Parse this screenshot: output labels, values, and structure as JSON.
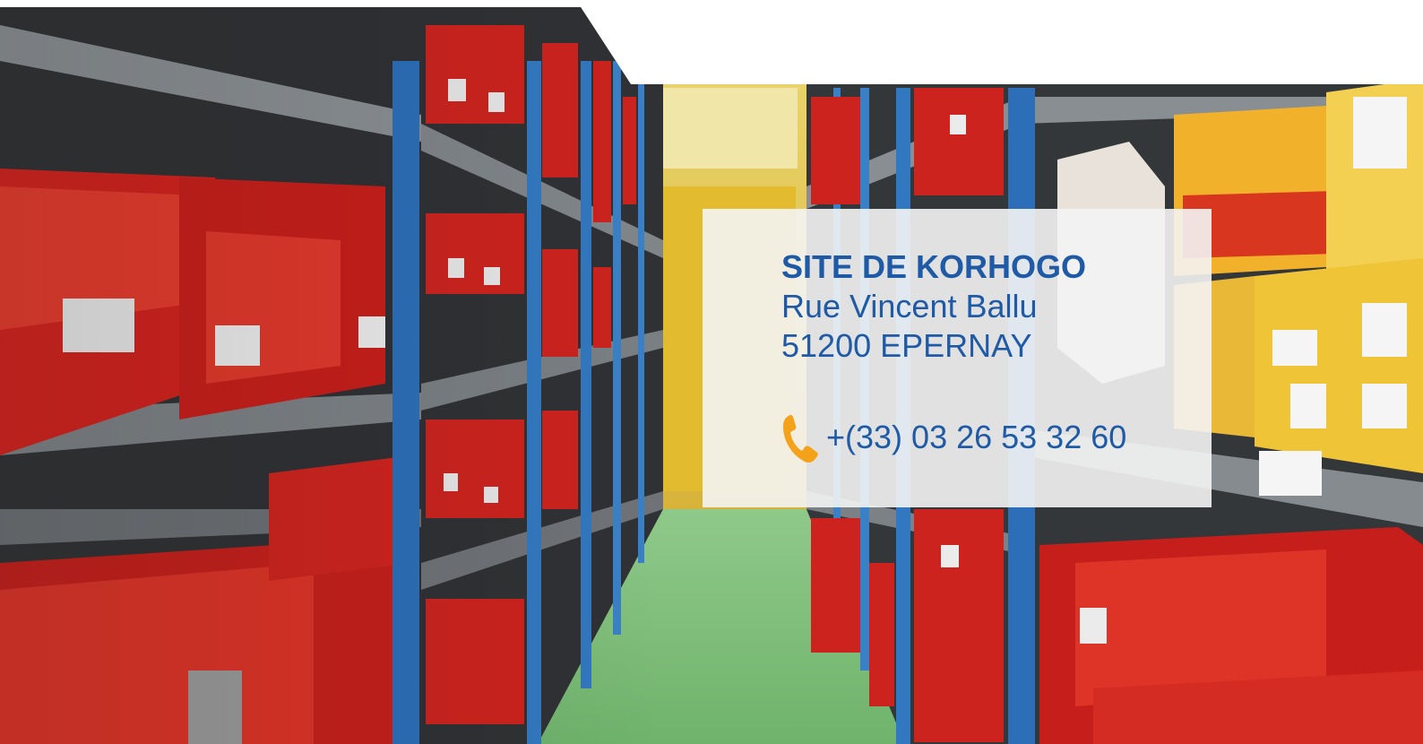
{
  "contact_card": {
    "site_name": "SITE DE KORHOGO",
    "address_line_1": "Rue Vincent Ballu",
    "address_line_2": "51200 EPERNAY",
    "phone": "+(33) 03 26 53 32 60",
    "phone_icon": "phone-icon"
  },
  "colors": {
    "text": "#1f5aa6",
    "phone_icon": "#f5a21b",
    "card_background": "#f4f4f4"
  }
}
